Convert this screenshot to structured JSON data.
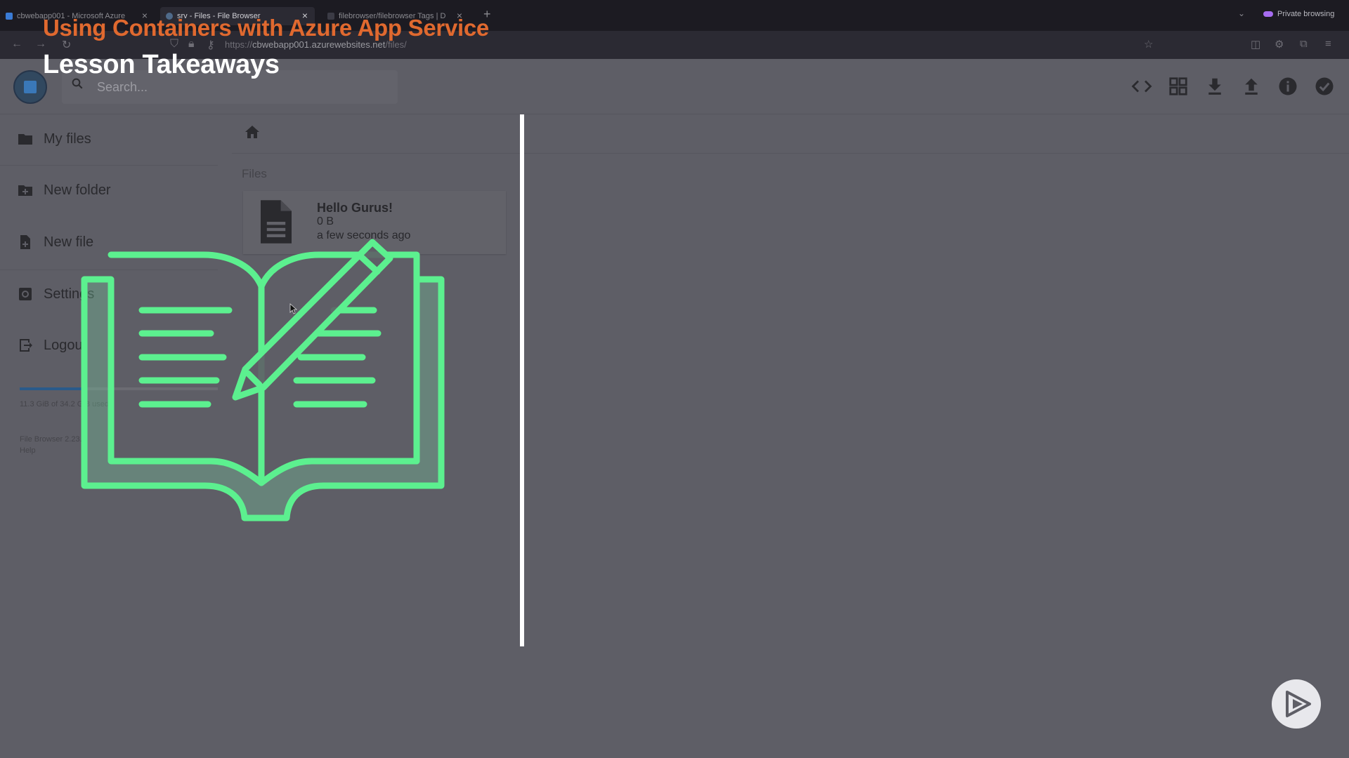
{
  "browser": {
    "tabs": [
      {
        "title": "cbwebapp001 - Microsoft Azure",
        "active": false
      },
      {
        "title": "srv - Files - File Browser",
        "active": true
      },
      {
        "title": "filebrowser/filebrowser Tags | D",
        "active": false
      }
    ],
    "url_prefix": "https://",
    "url_host": "cbwebapp001.azurewebsites.net",
    "url_path": "/files/",
    "private_label": "Private browsing"
  },
  "overlay": {
    "course_title": "Using Containers with Azure App Service",
    "lesson_title": "Lesson Takeaways",
    "accent_color": "#e0692f",
    "graphic_color": "#5cf08f"
  },
  "app": {
    "search_placeholder": "Search...",
    "header_actions": [
      "code-icon",
      "grid-view-icon",
      "download-icon",
      "upload-icon",
      "info-icon",
      "check-circle-icon"
    ],
    "sidebar": {
      "items": [
        {
          "label": "My files",
          "icon": "folder-icon"
        },
        {
          "label": "New folder",
          "icon": "new-folder-icon"
        },
        {
          "label": "New file",
          "icon": "new-file-icon"
        },
        {
          "label": "Settings",
          "icon": "settings-icon"
        },
        {
          "label": "Logout",
          "icon": "logout-icon"
        }
      ],
      "usage_text": "11.3 GiB of 34.2 GiB used",
      "usage_fraction": 0.33,
      "version": "File Browser 2.23.0",
      "help": "Help"
    },
    "files_section": "Files",
    "files": [
      {
        "name": "Hello Gurus!",
        "size": "0 B",
        "modified": "a few seconds ago"
      }
    ]
  }
}
